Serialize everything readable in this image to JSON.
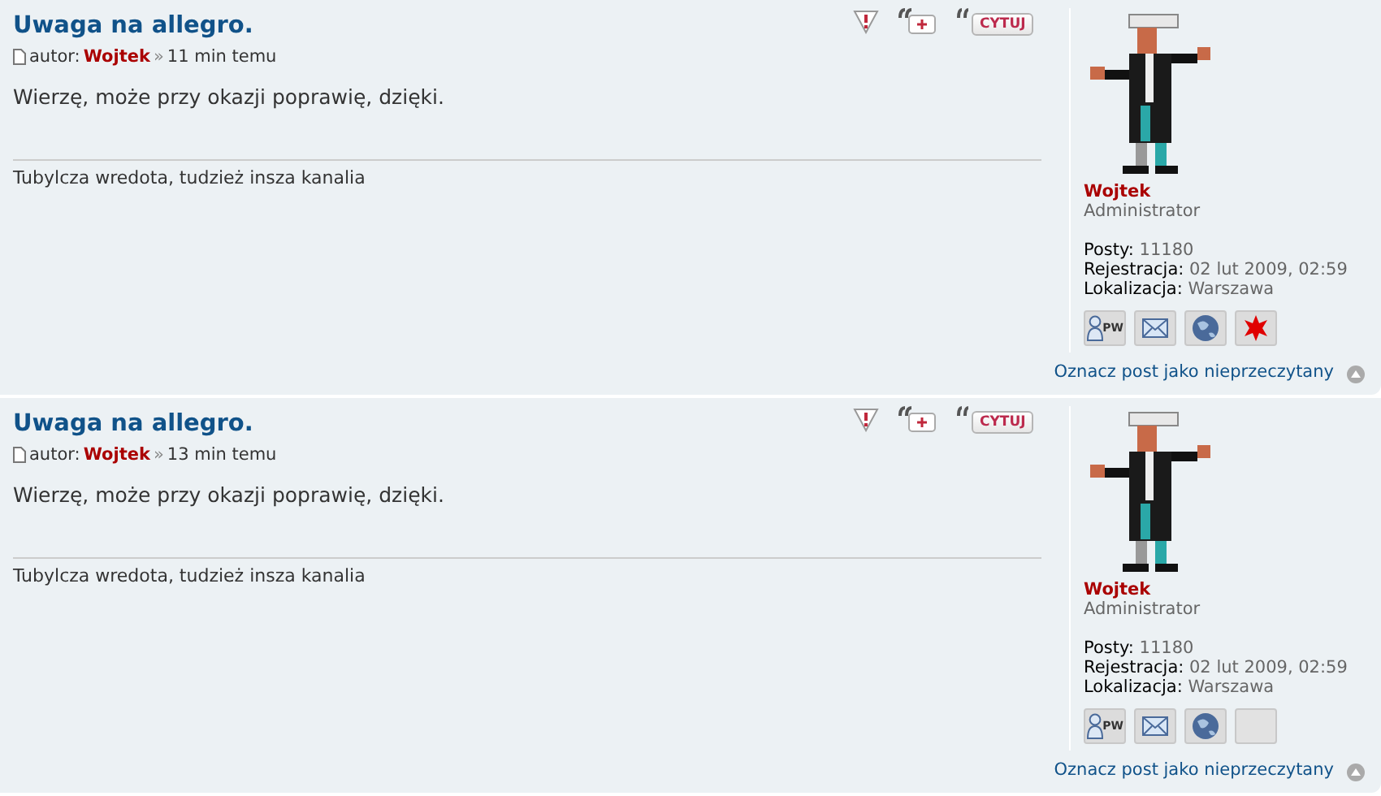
{
  "posts": [
    {
      "title": "Uwaga na allegro.",
      "author_label": "autor:",
      "author": "Wojtek",
      "sep": "»",
      "time": "11 min temu",
      "body": "Wierzę, może przy okazji poprawię, dzięki.",
      "signature": "Tubylcza wredota, tudzież insza kanalia",
      "quote_label": "CYTUJ",
      "profile": {
        "name": "Wojtek",
        "rank": "Administrator",
        "fields": [
          {
            "label": "Posty:",
            "value": "11180"
          },
          {
            "label": "Rejestracja:",
            "value": "02 lut 2009, 02:59"
          },
          {
            "label": "Lokalizacja:",
            "value": "Warszawa"
          }
        ],
        "contacts": [
          {
            "kind": "pm",
            "label": "PW"
          },
          {
            "kind": "email"
          },
          {
            "kind": "www"
          },
          {
            "kind": "gg"
          }
        ]
      },
      "unread_link": "Oznacz post jako nieprzeczytany"
    },
    {
      "title": "Uwaga na allegro.",
      "author_label": "autor:",
      "author": "Wojtek",
      "sep": "»",
      "time": "13 min temu",
      "body": "Wierzę, może przy okazji poprawię, dzięki.",
      "signature": "Tubylcza wredota, tudzież insza kanalia",
      "quote_label": "CYTUJ",
      "profile": {
        "name": "Wojtek",
        "rank": "Administrator",
        "fields": [
          {
            "label": "Posty:",
            "value": "11180"
          },
          {
            "label": "Rejestracja:",
            "value": "02 lut 2009, 02:59"
          },
          {
            "label": "Lokalizacja:",
            "value": "Warszawa"
          }
        ],
        "contacts": [
          {
            "kind": "pm",
            "label": "PW"
          },
          {
            "kind": "email"
          },
          {
            "kind": "www"
          },
          {
            "kind": "empty"
          }
        ]
      },
      "unread_link": "Oznacz post jako nieprzeczytany"
    }
  ]
}
